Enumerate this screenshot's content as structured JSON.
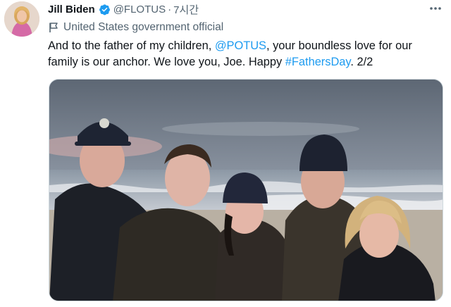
{
  "author": {
    "name": "Jill Biden",
    "handle": "@FLOTUS",
    "separator": "·",
    "time": "7시간",
    "label": "United States government official"
  },
  "icons": {
    "verified": "verified-badge-icon",
    "flag": "flag-icon",
    "more": "more-options-icon"
  },
  "tweet": {
    "part1": "And to the father of my children, ",
    "mention": "@POTUS",
    "part2": ", your boundless love for our family is our anchor. We love you, Joe. Happy ",
    "hashtag": "#FathersDay",
    "part3": ". 2/2"
  },
  "colors": {
    "accent": "#1d9bf0",
    "secondary_text": "#536471",
    "text": "#0f1419"
  }
}
